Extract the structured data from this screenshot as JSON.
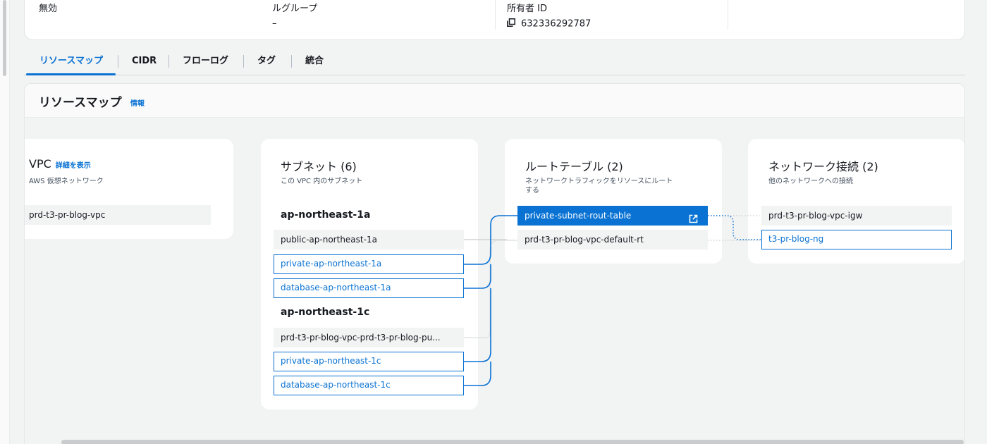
{
  "summary": {
    "col1_label": "無効",
    "col2_label": "ルグループ",
    "col2_value": "–",
    "col3_label": "所有者 ID",
    "col3_value": "632336292787"
  },
  "tabs": [
    {
      "label": "リソースマップ",
      "active": true
    },
    {
      "label": "CIDR"
    },
    {
      "label": "フローログ"
    },
    {
      "label": "タグ"
    },
    {
      "label": "統合"
    }
  ],
  "resource_map": {
    "title": "リソースマップ",
    "info_link": "情報",
    "vpc": {
      "title": "VPC",
      "detail_link": "詳細を表示",
      "subtitle": "AWS 仮想ネットワーク",
      "item": "prd-t3-pr-blog-vpc"
    },
    "subnets": {
      "title": "サブネット (6)",
      "subtitle": "この VPC 内のサブネット",
      "az1": {
        "name": "ap-northeast-1a",
        "items": [
          "public-ap-northeast-1a",
          "private-ap-northeast-1a",
          "database-ap-northeast-1a"
        ]
      },
      "az2": {
        "name": "ap-northeast-1c",
        "items": [
          "prd-t3-pr-blog-vpc-prd-t3-pr-blog-pu...",
          "private-ap-northeast-1c",
          "database-ap-northeast-1c"
        ]
      }
    },
    "route_tables": {
      "title": "ルートテーブル (2)",
      "subtitle_line1": "ネットワークトラフィックをリソースにルート",
      "subtitle_line2": "する",
      "items": [
        "private-subnet-rout-table",
        "prd-t3-pr-blog-vpc-default-rt"
      ]
    },
    "network_connections": {
      "title": "ネットワーク接続 (2)",
      "subtitle": "他のネットワークへの接続",
      "items": [
        "prd-t3-pr-blog-vpc-igw",
        "t3-pr-blog-ng"
      ]
    }
  },
  "colors": {
    "accent": "#0972d3",
    "item_bg": "#f2f3f3",
    "panel_bg": "#f2f3f3"
  }
}
